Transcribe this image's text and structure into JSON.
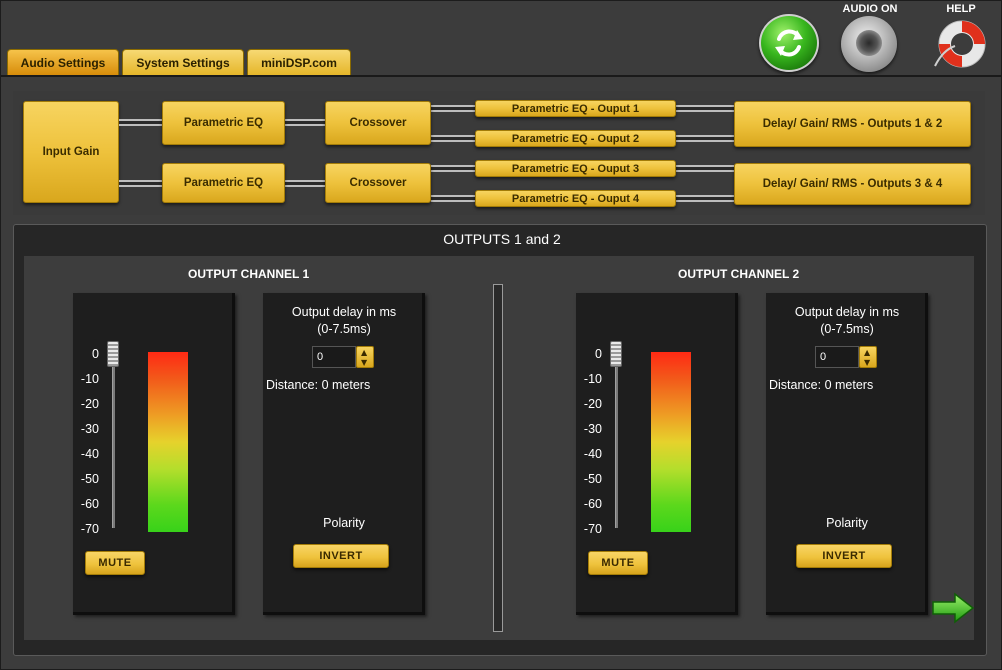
{
  "top_controls": {
    "refresh": {
      "icon": "refresh-icon"
    },
    "audio": {
      "label": "AUDIO ON",
      "icon": "speaker-icon"
    },
    "help": {
      "label": "HELP",
      "icon": "lifebuoy-icon"
    }
  },
  "tabs": [
    {
      "label": "Audio Settings",
      "active": true
    },
    {
      "label": "System Settings",
      "active": false
    },
    {
      "label": "miniDSP.com",
      "active": false
    }
  ],
  "signal_chain": {
    "input_gain": "Input Gain",
    "row1": {
      "peq": "Parametric EQ",
      "crossover": "Crossover",
      "out_a": "Parametric EQ - Ouput 1",
      "out_b": "Parametric EQ - Ouput 2",
      "delay": "Delay/ Gain/ RMS - Outputs 1 & 2"
    },
    "row2": {
      "peq": "Parametric EQ",
      "crossover": "Crossover",
      "out_a": "Parametric EQ - Ouput 3",
      "out_b": "Parametric EQ - Ouput 4",
      "delay": "Delay/ Gain/ RMS - Outputs 3 & 4"
    }
  },
  "outputs": {
    "title": "OUTPUTS 1 and 2",
    "scale": [
      "0",
      "-10",
      "-20",
      "-30",
      "-40",
      "-50",
      "-60",
      "-70"
    ],
    "channels": [
      {
        "title": "OUTPUT CHANNEL 1",
        "gain_db": 0,
        "mute_label": "MUTE",
        "delay_label_line1": "Output delay in ms",
        "delay_label_line2": "(0-7.5ms)",
        "delay_value": "0",
        "distance": "Distance: 0 meters",
        "polarity_label": "Polarity",
        "invert_label": "INVERT"
      },
      {
        "title": "OUTPUT CHANNEL 2",
        "gain_db": 0,
        "mute_label": "MUTE",
        "delay_label_line1": "Output delay in ms",
        "delay_label_line2": "(0-7.5ms)",
        "delay_value": "0",
        "distance": "Distance: 0 meters",
        "polarity_label": "Polarity",
        "invert_label": "INVERT"
      }
    ]
  },
  "colors": {
    "accent_gold": "#f0c440",
    "active_tab": "#e8a020",
    "meter_top": "#ff2a14",
    "meter_bottom": "#38d21a",
    "next_arrow": "#3ccf1a"
  }
}
